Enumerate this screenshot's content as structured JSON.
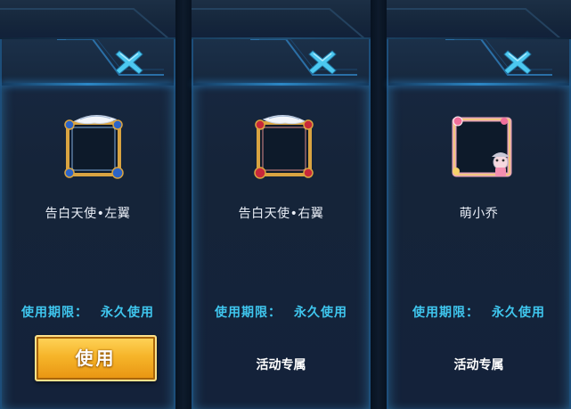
{
  "cards": [
    {
      "frame_icon": "angel-left-wing-frame-icon",
      "name": "告白天使•左翼",
      "limit_label": "使用期限：",
      "limit_value": "永久使用",
      "action_label": "使用"
    },
    {
      "frame_icon": "angel-right-wing-frame-icon",
      "name": "告白天使•右翼",
      "limit_label": "使用期限：",
      "limit_value": "永久使用",
      "status_label": "活动专属"
    },
    {
      "frame_icon": "cute-xiao-qiao-frame-icon",
      "name": "萌小乔",
      "limit_label": "使用期限：",
      "limit_value": "永久使用",
      "status_label": "活动专属"
    }
  ],
  "close_icon": "close-x-icon",
  "colors": {
    "accent_blue": "#3fc6ee",
    "button_gold": "#f6b52a",
    "panel_bg": "#152439",
    "close_x": "#4cc8f0"
  }
}
